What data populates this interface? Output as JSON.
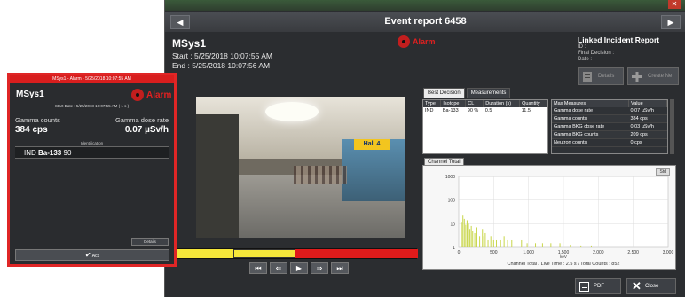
{
  "event": {
    "title": "Event report 6458",
    "system": "MSys1",
    "start": "Start : 5/25/2018 10:07:55 AM",
    "end": "End : 5/25/2018 10:07:56 AM",
    "alarm_label": "Alarm",
    "video_sign": "Hall 4"
  },
  "linked": {
    "title": "Linked Incident Report",
    "id_label": "ID :",
    "final_decision_label": "Final Decision :",
    "date_label": "Date :",
    "details_label": "Details",
    "create_label": "Create Ne"
  },
  "tabs": [
    "Best Decision",
    "Measurements"
  ],
  "identification_table": {
    "headers": [
      "Type",
      "Isotope",
      "CL",
      "Duration (s)",
      "Quantity"
    ],
    "rows": [
      [
        "IND",
        "Ba-133",
        "90 %",
        "0.5",
        "11.5"
      ]
    ]
  },
  "measures_table": {
    "headers": [
      "Max Measures",
      "Value"
    ],
    "rows": [
      [
        "Gamma dose rate",
        "0.07 µSv/h"
      ],
      [
        "Gamma counts",
        "384 cps"
      ],
      [
        "Gamma BKG dose rate",
        "0.03 µSv/h"
      ],
      [
        "Gamma BKG counts",
        "209 cps"
      ],
      [
        "Neutron counts",
        "0 cps"
      ]
    ]
  },
  "chart_tab": "Channel Total",
  "chart_button": "Std",
  "chart_footer": "Channel Total / Live Time : 2.5 s / Total Counts : 852",
  "chart_data": {
    "type": "bar",
    "title": "",
    "xlabel": "keV",
    "ylabel": "",
    "xlim": [
      0,
      3000
    ],
    "ylim_log": [
      1,
      1000
    ],
    "log_y": true,
    "x_ticks": [
      "0",
      "500",
      "1,000",
      "1,500",
      "2,000",
      "2,500",
      "3,000"
    ],
    "y_ticks": [
      "1",
      "10",
      "100",
      "1000"
    ],
    "series": [
      {
        "color": "#c8d64a",
        "x": [
          40,
          60,
          80,
          100,
          120,
          140,
          160,
          180,
          200,
          230,
          260,
          300,
          340,
          360,
          380,
          420,
          460,
          500,
          540,
          600,
          650,
          700,
          760,
          820,
          900,
          980,
          1100,
          1200,
          1320,
          1450,
          1600,
          1750,
          1900
        ],
        "y": [
          12,
          22,
          16,
          9,
          14,
          10,
          6,
          8,
          5,
          4,
          7,
          3,
          6,
          3,
          4,
          2,
          3,
          2,
          2,
          2,
          3,
          2,
          2,
          1.5,
          2,
          1.5,
          1.5,
          1.5,
          1.5,
          1.5,
          1.3,
          1.2,
          1.2
        ]
      }
    ]
  },
  "footer": {
    "pdf": "PDF",
    "close": "Close"
  },
  "popup": {
    "title": "MSys1 - Alarm - 5/25/2018 10:07:55 AM",
    "name": "MSys1",
    "alarm": "Alarm",
    "start": "Start Date : 5/25/2018 10:07:55 AM ( 1 s )",
    "gamma_counts_label": "Gamma counts",
    "gamma_counts_value": "384 cps",
    "gamma_dose_label": "Gamma dose rate",
    "gamma_dose_value": "0.07 µSv/h",
    "identification_label": "Identification",
    "identification_type": "IND",
    "identification_isotope": "Ba-133",
    "identification_cl": "90",
    "details": "Details",
    "ack": "Ack"
  }
}
